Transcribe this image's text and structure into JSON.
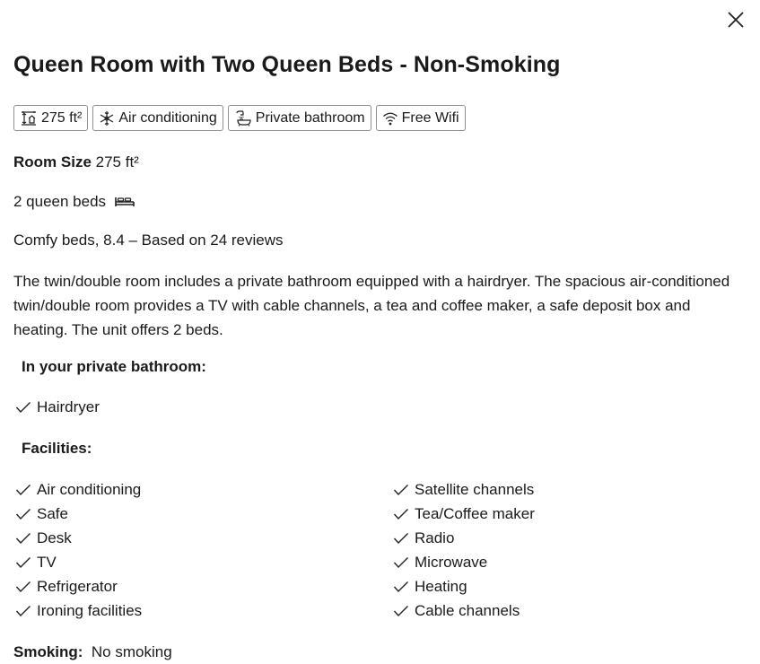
{
  "modal": {
    "title": "Queen Room with Two Queen Beds - Non-Smoking",
    "close_icon": "close-icon"
  },
  "chips": [
    {
      "icon": "room-size-icon",
      "label": "275 ft²"
    },
    {
      "icon": "snowflake-icon",
      "label": "Air conditioning"
    },
    {
      "icon": "bathroom-icon",
      "label": "Private bathroom"
    },
    {
      "icon": "wifi-icon",
      "label": "Free Wifi"
    }
  ],
  "room_size": {
    "label": "Room Size",
    "value": "275 ft²"
  },
  "beds": {
    "text": "2 queen beds",
    "icon": "bed-icon"
  },
  "rating": {
    "text": "Comfy beds, 8.4 – Based on 24 reviews"
  },
  "description": "The twin/double room includes a private bathroom equipped with a hairdryer. The spacious air-conditioned twin/double room provides a TV with cable channels, a tea and coffee maker, a safe deposit box and heating. The unit offers 2 beds.",
  "bathroom": {
    "heading": "In your private bathroom:",
    "items": [
      "Hairdryer"
    ]
  },
  "facilities": {
    "heading": "Facilities:",
    "left": [
      "Air conditioning",
      "Safe",
      "Desk",
      "TV",
      "Refrigerator",
      "Ironing facilities"
    ],
    "right": [
      "Satellite channels",
      "Tea/Coffee maker",
      "Radio",
      "Microwave",
      "Heating",
      "Cable channels"
    ]
  },
  "smoking": {
    "label": "Smoking:",
    "value": "No smoking"
  }
}
